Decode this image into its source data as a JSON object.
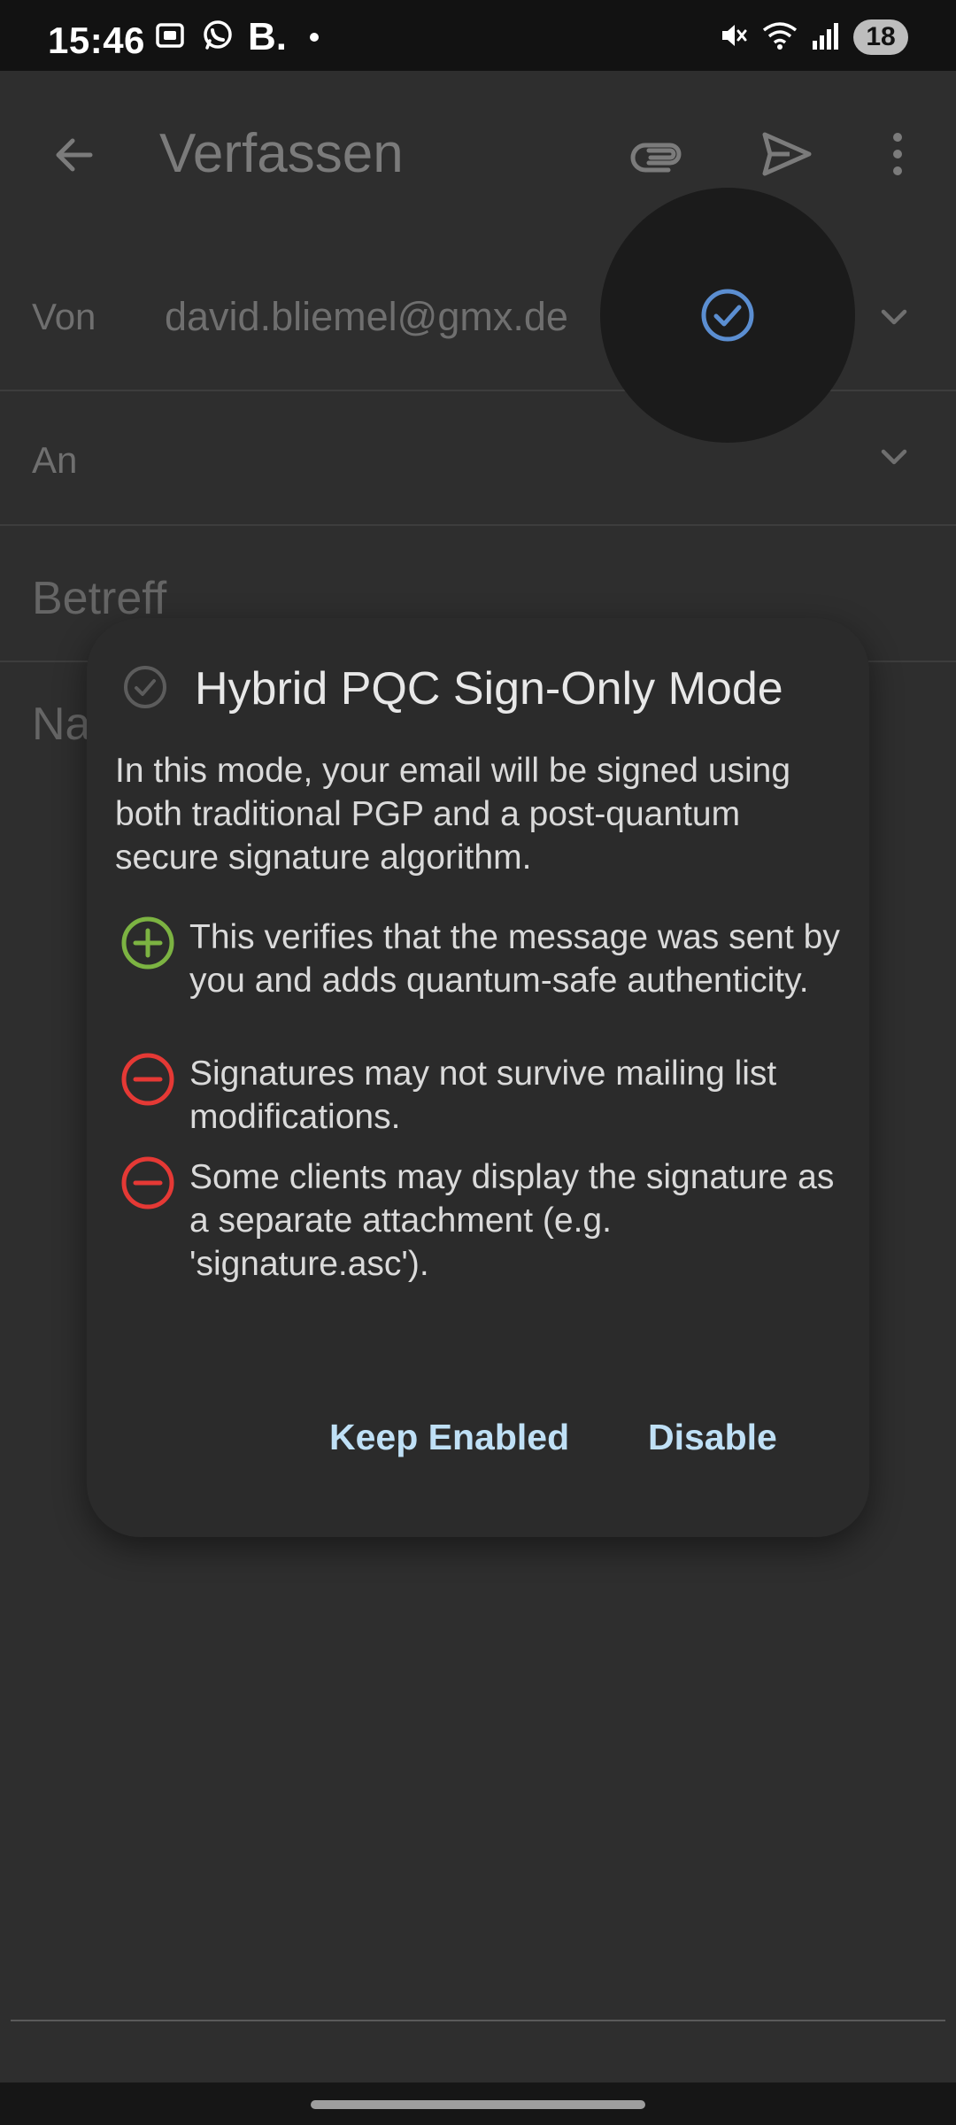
{
  "status_bar": {
    "time": "15:46",
    "app_glyph": "B.",
    "battery": "18",
    "icons": [
      "screenshot-icon",
      "whatsapp-icon",
      "mute-icon",
      "wifi-icon",
      "signal-icon"
    ]
  },
  "app_bar": {
    "title": "Verfassen",
    "actions": [
      "attach-icon",
      "send-icon",
      "more-vert-icon"
    ]
  },
  "form": {
    "from_label": "Von",
    "from_value": "david.bliemel@gmx.de",
    "to_label": "An",
    "subject_placeholder": "Betreff",
    "body_placeholder_visible": "Na"
  },
  "dialog": {
    "title": "Hybrid PQC Sign-Only Mode",
    "description": "In this mode, your email will be signed using both traditional PGP and a post-quantum secure signature algorithm.",
    "points": [
      {
        "type": "pro",
        "icon": "plus-circle-icon",
        "text": "This verifies that the message was sent by you and adds quantum-safe authenticity."
      },
      {
        "type": "con",
        "icon": "minus-circle-icon",
        "text": "Signatures may not survive mailing list modifications."
      },
      {
        "type": "con",
        "icon": "minus-circle-icon",
        "text": "Some clients may display the signature as a separate attachment (e.g. 'signature.asc')."
      }
    ],
    "buttons": {
      "keep": "Keep Enabled",
      "disable": "Disable"
    }
  },
  "colors": {
    "background": "#2e2e2e",
    "dialog": "#2b2b2b",
    "button_text": "#bfe0f6",
    "pro_icon": "#7cb342",
    "con_icon": "#e53935",
    "check_accent": "#5b8ed1"
  }
}
